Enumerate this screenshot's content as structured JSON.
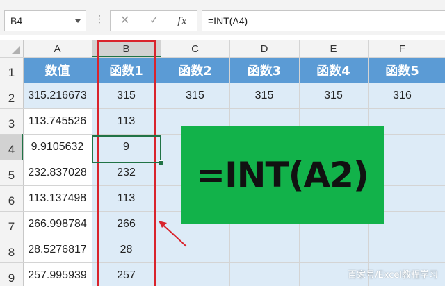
{
  "formula_bar": {
    "name_box": "B4",
    "dots": "⋮",
    "cancel_symbol": "✕",
    "enter_symbol": "✓",
    "fx_symbol": "fx",
    "formula": "=INT(A4)"
  },
  "columns": [
    "A",
    "B",
    "C",
    "D",
    "E",
    "F"
  ],
  "rows": [
    "1",
    "2",
    "3",
    "4",
    "5",
    "6",
    "7",
    "8",
    "9"
  ],
  "header_row": [
    "数值",
    "函数1",
    "函数2",
    "函数3",
    "函数4",
    "函数5"
  ],
  "data_rows": [
    [
      "315.216673",
      "315",
      "315",
      "315",
      "315",
      "316"
    ],
    [
      "113.745526",
      "113",
      "",
      "",
      "",
      ""
    ],
    [
      "9.9105632",
      "9",
      "",
      "",
      "",
      ""
    ],
    [
      "232.837028",
      "232",
      "",
      "",
      "",
      ""
    ],
    [
      "113.137498",
      "113",
      "",
      "",
      "",
      ""
    ],
    [
      "266.998784",
      "266",
      "",
      "",
      "",
      ""
    ],
    [
      "28.5276817",
      "28",
      "",
      "",
      "",
      ""
    ],
    [
      "257.995939",
      "257",
      "",
      "",
      "",
      ""
    ]
  ],
  "formula_callout": "=INT(A2)",
  "watermark": "百家号/Excel教程学习",
  "colors": {
    "header_fill": "#5b9bd5",
    "data_fill": "#ddebf7",
    "callout_fill": "#12b24a",
    "highlight": "#d9232c",
    "selection": "#217346"
  }
}
